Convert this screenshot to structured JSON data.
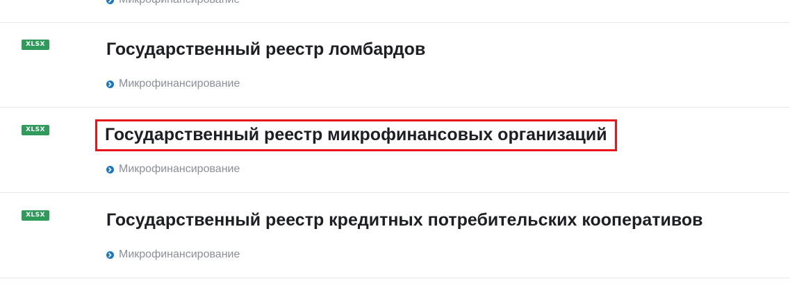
{
  "rows": [
    {
      "badge": "",
      "title": "",
      "category": "Микрофинансирование"
    },
    {
      "badge": "XLSX",
      "title": "Государственный реестр ломбардов",
      "category": "Микрофинансирование"
    },
    {
      "badge": "XLSX",
      "title": "Государственный реестр микрофинансовых организаций",
      "category": "Микрофинансирование"
    },
    {
      "badge": "XLSX",
      "title": "Государственный реестр кредитных потребительских кооперативов",
      "category": "Микрофинансирование"
    }
  ],
  "colors": {
    "badge_bg": "#2e9b5b",
    "category_icon": "#1a78c2",
    "highlight_border": "#e8141a"
  },
  "icons": {
    "category": "arrow-circle-right-icon"
  }
}
